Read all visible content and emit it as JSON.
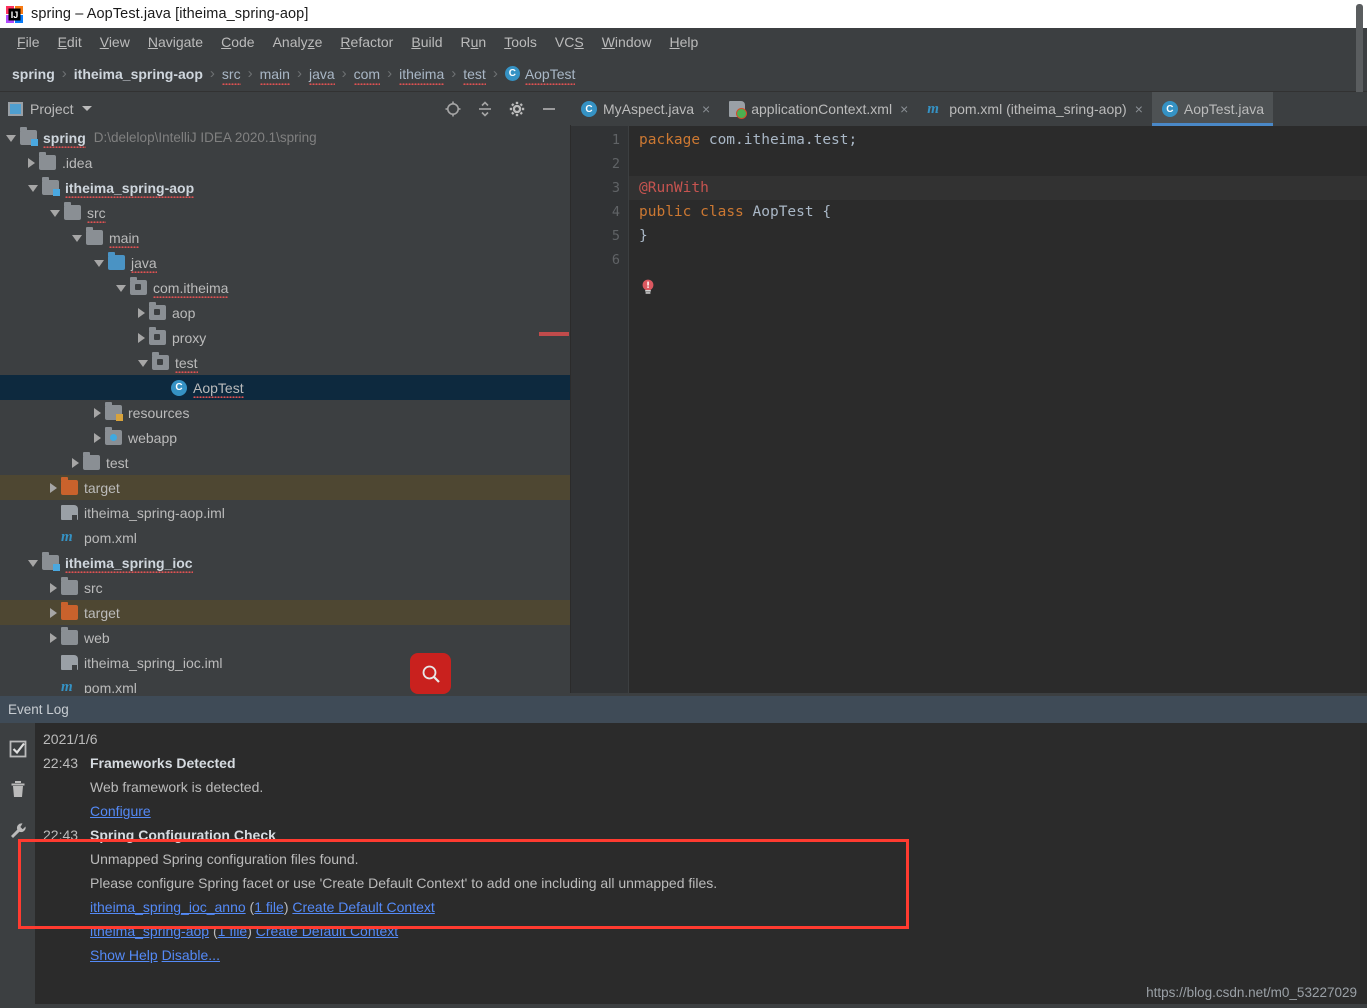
{
  "window": {
    "title": "spring – AopTest.java [itheima_spring-aop]",
    "logo_icon": "intellij-idea-logo"
  },
  "menubar": {
    "items": [
      {
        "label": "File",
        "mnemonic": "F"
      },
      {
        "label": "Edit",
        "mnemonic": "E"
      },
      {
        "label": "View",
        "mnemonic": "V"
      },
      {
        "label": "Navigate",
        "mnemonic": "N"
      },
      {
        "label": "Code",
        "mnemonic": "C"
      },
      {
        "label": "Analyze",
        "mnemonic": "z"
      },
      {
        "label": "Refactor",
        "mnemonic": "R"
      },
      {
        "label": "Build",
        "mnemonic": "B"
      },
      {
        "label": "Run",
        "mnemonic": "u"
      },
      {
        "label": "Tools",
        "mnemonic": "T"
      },
      {
        "label": "VCS",
        "mnemonic": "S"
      },
      {
        "label": "Window",
        "mnemonic": "W"
      },
      {
        "label": "Help",
        "mnemonic": "H"
      }
    ]
  },
  "breadcrumb": {
    "items": [
      {
        "label": "spring",
        "style": "bold"
      },
      {
        "label": "itheima_spring-aop",
        "style": "bold"
      },
      {
        "label": "src",
        "style": "link"
      },
      {
        "label": "main",
        "style": "link"
      },
      {
        "label": "java",
        "style": "link"
      },
      {
        "label": "com",
        "style": "link"
      },
      {
        "label": "itheima",
        "style": "link"
      },
      {
        "label": "test",
        "style": "link"
      },
      {
        "label": "AopTest",
        "style": "class",
        "icon": "class-icon"
      }
    ],
    "separator": "›"
  },
  "project_panel": {
    "title": "Project",
    "caret_icon": "chevron-down-icon",
    "panel_icon": "project-view-icon",
    "tools": [
      {
        "name": "locate-in-tree-icon",
        "title": "Select Opened File"
      },
      {
        "name": "collapse-all-icon",
        "title": "Collapse All"
      },
      {
        "name": "gear-icon",
        "title": "Settings"
      },
      {
        "name": "minimize-icon",
        "title": "Hide"
      }
    ],
    "tree": [
      {
        "label": "spring",
        "path": "D:\\delelop\\IntelliJ IDEA 2020.1\\spring",
        "indent": 0,
        "arrow": "open",
        "icon": "module-folder",
        "bold": true,
        "squiggle": true
      },
      {
        "label": ".idea",
        "indent": 1,
        "arrow": "closed",
        "icon": "folder"
      },
      {
        "label": "itheima_spring-aop",
        "indent": 1,
        "arrow": "open",
        "icon": "module-folder",
        "bold": true,
        "squiggle": true
      },
      {
        "label": "src",
        "indent": 2,
        "arrow": "open",
        "icon": "folder",
        "squiggle": true
      },
      {
        "label": "main",
        "indent": 3,
        "arrow": "open",
        "icon": "folder",
        "squiggle": true
      },
      {
        "label": "java",
        "indent": 4,
        "arrow": "open",
        "icon": "source-folder",
        "squiggle": true
      },
      {
        "label": "com.itheima",
        "indent": 5,
        "arrow": "open",
        "icon": "package",
        "squiggle": true
      },
      {
        "label": "aop",
        "indent": 6,
        "arrow": "closed",
        "icon": "package"
      },
      {
        "label": "proxy",
        "indent": 6,
        "arrow": "closed",
        "icon": "package"
      },
      {
        "label": "test",
        "indent": 6,
        "arrow": "open",
        "icon": "package",
        "squiggle": true
      },
      {
        "label": "AopTest",
        "indent": 7,
        "arrow": "none",
        "icon": "class",
        "selected": true,
        "squiggle": true
      },
      {
        "label": "resources",
        "indent": 4,
        "arrow": "closed",
        "icon": "resources-folder"
      },
      {
        "label": "webapp",
        "indent": 4,
        "arrow": "closed",
        "icon": "webapp-folder"
      },
      {
        "label": "test",
        "indent": 3,
        "arrow": "closed",
        "icon": "folder"
      },
      {
        "label": "target",
        "indent": 2,
        "arrow": "closed",
        "icon": "excluded-folder",
        "highlight": "target"
      },
      {
        "label": "itheima_spring-aop.iml",
        "indent": 2,
        "arrow": "none",
        "icon": "iml"
      },
      {
        "label": "pom.xml",
        "indent": 2,
        "arrow": "none",
        "icon": "maven"
      },
      {
        "label": "itheima_spring_ioc",
        "indent": 1,
        "arrow": "open",
        "icon": "module-folder",
        "bold": true,
        "squiggle": true
      },
      {
        "label": "src",
        "indent": 2,
        "arrow": "closed",
        "icon": "folder"
      },
      {
        "label": "target",
        "indent": 2,
        "arrow": "closed",
        "icon": "excluded-folder",
        "highlight": "target"
      },
      {
        "label": "web",
        "indent": 2,
        "arrow": "closed",
        "icon": "folder"
      },
      {
        "label": "itheima_spring_ioc.iml",
        "indent": 2,
        "arrow": "none",
        "icon": "iml"
      },
      {
        "label": "pom.xml",
        "indent": 2,
        "arrow": "none",
        "icon": "maven"
      }
    ],
    "search_fab_icon": "search-icon"
  },
  "editor": {
    "tabs": [
      {
        "label": "MyAspect.java",
        "icon": "class-icon",
        "active": false,
        "close": "×"
      },
      {
        "label": "applicationContext.xml",
        "icon": "spring-xml-icon",
        "active": false,
        "close": "×"
      },
      {
        "label": "pom.xml (itheima_sring-aop)",
        "icon": "maven-icon",
        "active": false,
        "close": "×"
      },
      {
        "label": "AopTest.java",
        "icon": "class-icon",
        "active": true,
        "close": ""
      }
    ],
    "line_numbers": [
      "1",
      "2",
      "3",
      "4",
      "5",
      "6"
    ],
    "code": [
      {
        "num": 1,
        "tokens": [
          {
            "t": "package",
            "c": "kw"
          },
          {
            "t": " com.itheima.test;",
            "c": "pl"
          }
        ]
      },
      {
        "num": 2,
        "tokens": []
      },
      {
        "num": 3,
        "highlighted": true,
        "tokens": [
          {
            "t": "@RunWith",
            "c": "err"
          }
        ]
      },
      {
        "num": 4,
        "tokens": [
          {
            "t": "public",
            "c": "kw"
          },
          {
            "t": " ",
            "c": "pl"
          },
          {
            "t": "class",
            "c": "kw"
          },
          {
            "t": " AopTest {",
            "c": "pl"
          }
        ]
      },
      {
        "num": 5,
        "tokens": [
          {
            "t": "}",
            "c": "pl"
          }
        ]
      },
      {
        "num": 6,
        "tokens": []
      }
    ],
    "intention_bulb_icon": "error-bulb-icon"
  },
  "event_log": {
    "title": "Event Log",
    "side_icons": [
      {
        "name": "mark-all-read-icon"
      },
      {
        "name": "trash-icon"
      },
      {
        "name": "wrench-settings-icon"
      }
    ],
    "entries": [
      {
        "type": "date",
        "text": "2021/1/6"
      },
      {
        "type": "entry",
        "time": "22:43",
        "title": "Frameworks Detected",
        "lines": [
          "Web framework is detected."
        ],
        "links": [
          "Configure"
        ]
      },
      {
        "type": "entry",
        "time": "22:43",
        "title": "Spring Configuration Check",
        "lines": [
          "Unmapped Spring configuration files found.",
          "Please configure Spring facet or use 'Create Default Context' to add one including all unmapped files."
        ],
        "link_rows": [
          [
            {
              "text": "itheima_spring_ioc_anno",
              "link": true
            },
            {
              "text": " (",
              "link": false
            },
            {
              "text": "1 file",
              "link": true
            },
            {
              "text": ")  ",
              "link": false
            },
            {
              "text": "Create Default Context",
              "link": true
            }
          ],
          [
            {
              "text": "itheima_spring-aop",
              "link": true
            },
            {
              "text": " (",
              "link": false
            },
            {
              "text": "1 file",
              "link": true
            },
            {
              "text": ")  ",
              "link": false
            },
            {
              "text": "Create Default Context",
              "link": true
            }
          ],
          [
            {
              "text": "Show Help",
              "link": true
            },
            {
              "text": "  ",
              "link": false
            },
            {
              "text": "Disable...",
              "link": true
            }
          ]
        ]
      }
    ]
  },
  "annotation": {
    "highlight_box_color": "#ff3b30"
  },
  "watermark": {
    "text": "https://blog.csdn.net/m0_53227029"
  },
  "colors": {
    "accent_blue": "#4a88c7",
    "selection": "#0d293e",
    "target_folder": "#4e4732",
    "error_red": "#c75450",
    "link_blue": "#548af7"
  }
}
